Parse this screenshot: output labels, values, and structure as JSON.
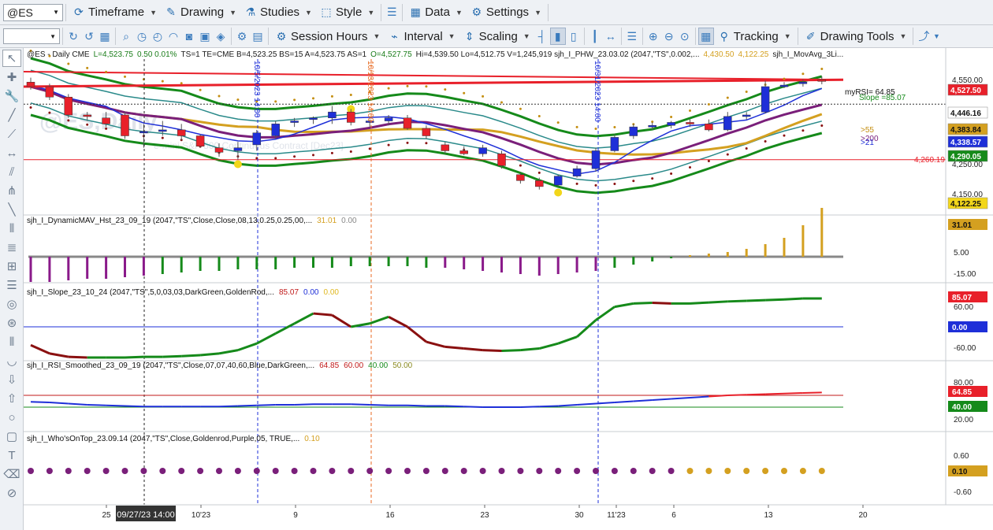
{
  "toolbar1": {
    "symbol": "@ES",
    "timeframe": "Timeframe",
    "drawing": "Drawing",
    "studies": "Studies",
    "style": "Style",
    "data": "Data",
    "settings": "Settings"
  },
  "toolbar2": {
    "session_hours": "Session Hours",
    "interval": "Interval",
    "scaling": "Scaling",
    "tracking": "Tracking",
    "drawing_tools": "Drawing Tools"
  },
  "sidebar_icons": [
    "cursor-icon",
    "crosshair-icon",
    "wrench-icon",
    "trendline-icon",
    "ray-icon",
    "horizontal-line-icon",
    "channel-icon",
    "pitchfork-icon",
    "ruler-icon",
    "bars-icon",
    "fibonacci-icon",
    "gann-icon",
    "levels-icon",
    "cycles-icon",
    "spiral-icon",
    "sticks-icon",
    "arc-icon",
    "arrow-down-icon",
    "arrow-up-icon",
    "ellipse-icon",
    "rectangle-icon",
    "text-icon",
    "eraser-icon",
    "delete-icon"
  ],
  "price_panel": {
    "header": [
      {
        "text": "@ES - Daily  CME",
        "color": "#1a1a1a"
      },
      {
        "text": "L=4,523.75",
        "color": "#1a7d1a"
      },
      {
        "text": "0.50  0.01%",
        "color": "#1a7d1a"
      },
      {
        "text": "TS=1  TE=CME  B=4,523.25  BS=15  A=4,523.75  AS=1",
        "color": "#1a1a1a"
      },
      {
        "text": "O=4,527.75",
        "color": "#1a7d1a"
      },
      {
        "text": "Hi=4,539.50  Lo=4,512.75  V=1,245,919  sjh_I_PHW_23.03.02 (2047,\"TS\",0.002,...",
        "color": "#1a1a1a"
      },
      {
        "text": "4,430.50",
        "color": "#d4a020"
      },
      {
        "text": "4,122.25",
        "color": "#d4a020"
      },
      {
        "text": "sjh_I_MovAvg_3Li...",
        "color": "#1a1a1a"
      }
    ],
    "watermark": "@ES,Daily",
    "watermark_sub": "e-mini S&P 500 Continuous Contract [Dec23]",
    "vlines": [
      {
        "label": "10/5/2023 14:00"
      },
      {
        "label": "10/13/2023 14:00"
      },
      {
        "label": "10/31/2023 14:00"
      }
    ],
    "annotations": {
      "myrsi": "myRSI= 64.85",
      "slope": "Slope =85.07",
      "gt55": ">55",
      "gt200": ">200",
      "gt21": ">21",
      "level": "4,260.19"
    },
    "axis_ticks": [
      "4,550.00",
      "4,250.00",
      "4,150.00"
    ],
    "price_tags": [
      {
        "text": "4,527.50",
        "bg": "#e8202a",
        "fg": "#ffffff"
      },
      {
        "text": "4,446.16",
        "bg": "#ffffff",
        "fg": "#111111"
      },
      {
        "text": "4,383.84",
        "bg": "#d4a020",
        "fg": "#111111"
      },
      {
        "text": "4,338.57",
        "bg": "#1e2fd8",
        "fg": "#ffffff"
      },
      {
        "text": "4,290.05",
        "bg": "#158a1a",
        "fg": "#ffffff"
      },
      {
        "text": "4,122.25",
        "bg": "#f2d61a",
        "fg": "#111111"
      }
    ]
  },
  "panel_mav": {
    "title": "sjh_I_DynamicMAV_Hst_23_09_19 (2047,\"TS\",Close,Close,08,13,0.25,0.25,00,...",
    "v1": "31.01",
    "v2": "0.00",
    "axis_ticks": [
      "5.00",
      "-15.00"
    ],
    "tag": "31.01"
  },
  "panel_slope": {
    "title": "sjh_I_Slope_23_10_24 (2047,\"TS\",5,0,03,03,DarkGreen,GoldenRod,...",
    "v1": "85.07",
    "v2": "0.00",
    "v3": "0.00",
    "axis_ticks": [
      "60.00",
      "-60.00"
    ],
    "tags": [
      "85.07",
      "0.00"
    ]
  },
  "panel_rsi": {
    "title": "sjh_I_RSI_Smoothed_23_09_19 (2047,\"TS\",Close,07,07,40,60,Blue,DarkGreen,...",
    "v1": "64.85",
    "v2": "60.00",
    "v3": "40.00",
    "v4": "50.00",
    "axis_ticks": [
      "80.00",
      "20.00"
    ],
    "tags": [
      "64.85",
      "40.00"
    ]
  },
  "panel_who": {
    "title": "sjh_I_Who'sOnTop_23.09.14 (2047,\"TS\",Close,Goldenrod,Purple,05,  TRUE,...",
    "v1": "0.10",
    "axis_ticks": [
      "0.60",
      "-0.60"
    ],
    "tag": "0.10"
  },
  "x_axis": {
    "ticks": [
      "25",
      "10'23",
      "9",
      "16",
      "23",
      "30",
      "11'23",
      "6",
      "13",
      "20"
    ],
    "cursor_label": "09/27/23 14:00"
  },
  "chart_data": {
    "type": "candlestick",
    "symbol": "@ES",
    "interval": "Daily",
    "y_range": [
      4100,
      4600
    ],
    "bars": [
      {
        "o": 4520,
        "h": 4535,
        "l": 4495,
        "c": 4505
      },
      {
        "o": 4505,
        "h": 4515,
        "l": 4460,
        "c": 4470
      },
      {
        "o": 4470,
        "h": 4480,
        "l": 4400,
        "c": 4410
      },
      {
        "o": 4410,
        "h": 4420,
        "l": 4390,
        "c": 4405
      },
      {
        "o": 4400,
        "h": 4420,
        "l": 4370,
        "c": 4380
      },
      {
        "o": 4410,
        "h": 4420,
        "l": 4330,
        "c": 4340
      },
      {
        "o": 4350,
        "h": 4380,
        "l": 4300,
        "c": 4355
      },
      {
        "o": 4355,
        "h": 4390,
        "l": 4340,
        "c": 4360
      },
      {
        "o": 4360,
        "h": 4380,
        "l": 4325,
        "c": 4340
      },
      {
        "o": 4340,
        "h": 4345,
        "l": 4300,
        "c": 4305
      },
      {
        "o": 4300,
        "h": 4315,
        "l": 4270,
        "c": 4285
      },
      {
        "o": 4290,
        "h": 4320,
        "l": 4260,
        "c": 4300
      },
      {
        "o": 4310,
        "h": 4360,
        "l": 4290,
        "c": 4350
      },
      {
        "o": 4340,
        "h": 4390,
        "l": 4330,
        "c": 4380
      },
      {
        "o": 4385,
        "h": 4400,
        "l": 4370,
        "c": 4390
      },
      {
        "o": 4395,
        "h": 4405,
        "l": 4380,
        "c": 4400
      },
      {
        "o": 4400,
        "h": 4440,
        "l": 4380,
        "c": 4420
      },
      {
        "o": 4420,
        "h": 4430,
        "l": 4375,
        "c": 4385
      },
      {
        "o": 4385,
        "h": 4395,
        "l": 4370,
        "c": 4390
      },
      {
        "o": 4390,
        "h": 4410,
        "l": 4375,
        "c": 4400
      },
      {
        "o": 4400,
        "h": 4410,
        "l": 4360,
        "c": 4365
      },
      {
        "o": 4365,
        "h": 4375,
        "l": 4330,
        "c": 4340
      },
      {
        "o": 4310,
        "h": 4320,
        "l": 4280,
        "c": 4290
      },
      {
        "o": 4290,
        "h": 4305,
        "l": 4275,
        "c": 4280
      },
      {
        "o": 4280,
        "h": 4310,
        "l": 4270,
        "c": 4300
      },
      {
        "o": 4280,
        "h": 4290,
        "l": 4230,
        "c": 4240
      },
      {
        "o": 4210,
        "h": 4215,
        "l": 4180,
        "c": 4190
      },
      {
        "o": 4190,
        "h": 4200,
        "l": 4160,
        "c": 4170
      },
      {
        "o": 4175,
        "h": 4210,
        "l": 4170,
        "c": 4205
      },
      {
        "o": 4205,
        "h": 4240,
        "l": 4200,
        "c": 4230
      },
      {
        "o": 4230,
        "h": 4300,
        "l": 4220,
        "c": 4290
      },
      {
        "o": 4290,
        "h": 4345,
        "l": 4285,
        "c": 4335
      },
      {
        "o": 4340,
        "h": 4380,
        "l": 4330,
        "c": 4370
      },
      {
        "o": 4370,
        "h": 4385,
        "l": 4360,
        "c": 4375
      },
      {
        "o": 4375,
        "h": 4390,
        "l": 4365,
        "c": 4385
      },
      {
        "o": 4385,
        "h": 4395,
        "l": 4370,
        "c": 4380
      },
      {
        "o": 4380,
        "h": 4395,
        "l": 4355,
        "c": 4360
      },
      {
        "o": 4360,
        "h": 4420,
        "l": 4355,
        "c": 4405
      },
      {
        "o": 4405,
        "h": 4420,
        "l": 4395,
        "c": 4410
      },
      {
        "o": 4420,
        "h": 4525,
        "l": 4415,
        "c": 4505
      },
      {
        "o": 4505,
        "h": 4520,
        "l": 4500,
        "c": 4510
      },
      {
        "o": 4515,
        "h": 4530,
        "l": 4505,
        "c": 4520
      },
      {
        "o": 4527.75,
        "h": 4539.5,
        "l": 4512.75,
        "c": 4523.75
      }
    ],
    "mav_hist": [
      -16,
      -16,
      -15,
      -14,
      -14,
      -13,
      -12,
      -11,
      -10,
      -9,
      -9,
      -8,
      -8,
      -8,
      -7,
      -7,
      -7,
      -6,
      -6,
      -6,
      -6,
      -7,
      -7,
      -8,
      -9,
      -10,
      -11,
      -12,
      -11,
      -10,
      -9,
      -7,
      -5,
      -3,
      -1,
      1,
      2,
      3,
      5,
      8,
      12,
      20,
      31.01
    ],
    "slope": [
      -55,
      -80,
      -90,
      -92,
      -92,
      -92,
      -90,
      -90,
      -88,
      -85,
      -80,
      -70,
      -50,
      -20,
      10,
      40,
      35,
      0,
      10,
      30,
      0,
      -45,
      -60,
      -65,
      -70,
      -72,
      -70,
      -65,
      -50,
      -30,
      20,
      60,
      70,
      72,
      70,
      70,
      73,
      76,
      78,
      80,
      82,
      85,
      85.07
    ],
    "rsi": [
      49,
      48,
      46,
      44,
      43,
      42,
      41,
      41,
      41,
      41,
      41,
      42,
      43,
      44,
      44,
      45,
      45,
      45,
      44,
      43,
      43,
      42,
      42,
      41,
      40,
      40,
      40,
      41,
      42,
      44,
      46,
      48,
      50,
      52,
      54,
      56,
      58,
      60,
      61,
      62,
      63,
      64,
      64.85
    ],
    "who_dots": 43,
    "who_gold_from": 35
  }
}
